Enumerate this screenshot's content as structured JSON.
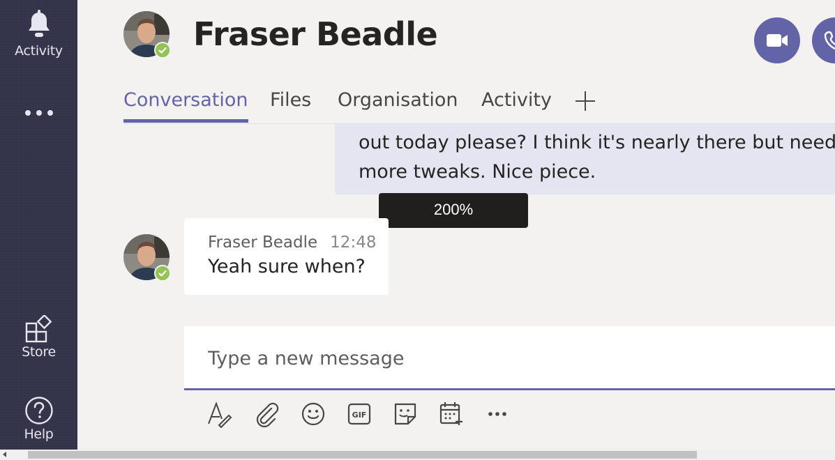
{
  "rail": {
    "items": [
      {
        "label": "Activity",
        "icon": "bell-icon"
      },
      {
        "label": "",
        "icon": "more-icon"
      },
      {
        "label": "Store",
        "icon": "store-icon"
      },
      {
        "label": "Help",
        "icon": "help-icon"
      }
    ]
  },
  "header": {
    "name": "Fraser Beadle",
    "presence": "available",
    "actions": [
      {
        "icon": "video-call-icon"
      },
      {
        "icon": "audio-call-icon"
      }
    ]
  },
  "tabs": [
    {
      "label": "Conversation",
      "active": true
    },
    {
      "label": "Files",
      "active": false
    },
    {
      "label": "Organisation",
      "active": false
    },
    {
      "label": "Activity",
      "active": false
    }
  ],
  "add_tab_icon": "plus-icon",
  "messages": {
    "mine": {
      "line1": "out today please? I think it's nearly there but needs a",
      "line2": "more tweaks. Nice piece."
    },
    "theirs": {
      "author": "Fraser Beadle",
      "time": "12:48",
      "body": "Yeah sure when?"
    }
  },
  "zoom_toast": "200%",
  "compose": {
    "placeholder": "Type a new message",
    "value": ""
  },
  "compose_tools": [
    {
      "icon": "format-icon"
    },
    {
      "icon": "attach-icon"
    },
    {
      "icon": "emoji-icon"
    },
    {
      "icon": "gif-icon"
    },
    {
      "icon": "sticker-icon"
    },
    {
      "icon": "schedule-meeting-icon"
    },
    {
      "icon": "more-options-icon"
    }
  ],
  "colors": {
    "accent": "#6264a7",
    "rail": "#33344a",
    "presence": "#92c353",
    "my_message": "#e5e5f1"
  }
}
